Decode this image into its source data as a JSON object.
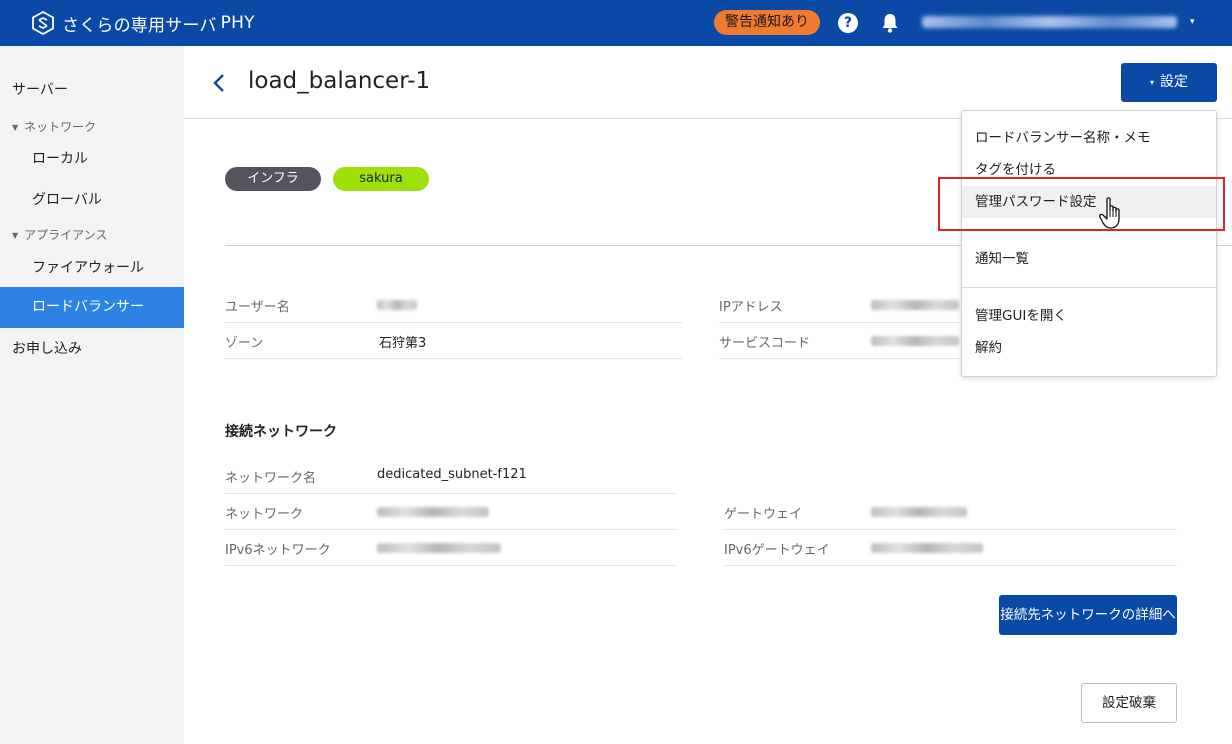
{
  "app": {
    "logo_text": "さくらの専用サーバ",
    "logo_suffix": "PHY",
    "warning_badge": "警告通知あり",
    "help_icon_text": "?",
    "account_caret": "▾"
  },
  "sidebar": {
    "items": [
      {
        "label": "サーバー"
      },
      {
        "label": "ネットワーク",
        "group_icon": "▼"
      },
      {
        "label": "ローカル"
      },
      {
        "label": "グローバル"
      },
      {
        "label": "アプライアンス",
        "group_icon": "▼"
      },
      {
        "label": "ファイアウォール"
      },
      {
        "label": "ロードバランサー"
      },
      {
        "label": "お申し込み"
      }
    ]
  },
  "page": {
    "title": "load_balancer-1",
    "settings_caret": "▾",
    "settings_label": "設定",
    "tags": [
      "インフラ",
      "sakura"
    ]
  },
  "info": {
    "user_label": "ユーザー名",
    "zone_label": "ゾーン",
    "zone_value": "石狩第3",
    "ip_label": "IPアドレス",
    "service_code_label": "サービスコード"
  },
  "network": {
    "section_title": "接続ネットワーク",
    "name_label": "ネットワーク名",
    "name_value": "dedicated_subnet-f121",
    "network_label": "ネットワーク",
    "gateway_label": "ゲートウェイ",
    "ipv6_network_label": "IPv6ネットワーク",
    "ipv6_gateway_label": "IPv6ゲートウェイ"
  },
  "buttons": {
    "network_detail": "接続先ネットワークの詳細へ",
    "discard": "設定破棄"
  },
  "dropdown": {
    "items": [
      {
        "label": "ロードバランサー名称・メモ"
      },
      {
        "label": "タグを付ける"
      },
      {
        "label": "管理パスワード設定"
      },
      {
        "label": "通知一覧"
      },
      {
        "label": "管理GUIを開く"
      },
      {
        "label": "解約"
      }
    ]
  },
  "colors": {
    "header_blue": "#0a4aa6",
    "active_nav": "#2d83e3",
    "warning_orange": "#f07a30",
    "tag_infra": "#54545f",
    "tag_sakura": "#9ee00a",
    "highlight_red": "#e0232a"
  }
}
